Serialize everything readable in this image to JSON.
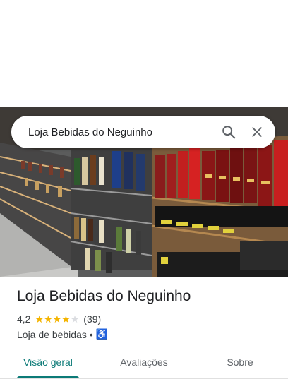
{
  "search": {
    "query": "Loja Bebidas do Neguinho",
    "search_icon": "search-icon",
    "close_icon": "close-icon"
  },
  "place": {
    "name": "Loja Bebidas do Neguinho",
    "rating": "4,2",
    "stars": 4.2,
    "reviews": "(39)",
    "category": "Loja de bebidas",
    "separator": "•",
    "accessibility_icon": "wheelchair-icon"
  },
  "tabs": [
    {
      "label": "Visão geral",
      "active": true
    },
    {
      "label": "Avaliações",
      "active": false
    },
    {
      "label": "Sobre",
      "active": false
    }
  ],
  "colors": {
    "accent": "#0b7a77",
    "star": "#f4b400",
    "accessibility": "#1a73e8"
  }
}
